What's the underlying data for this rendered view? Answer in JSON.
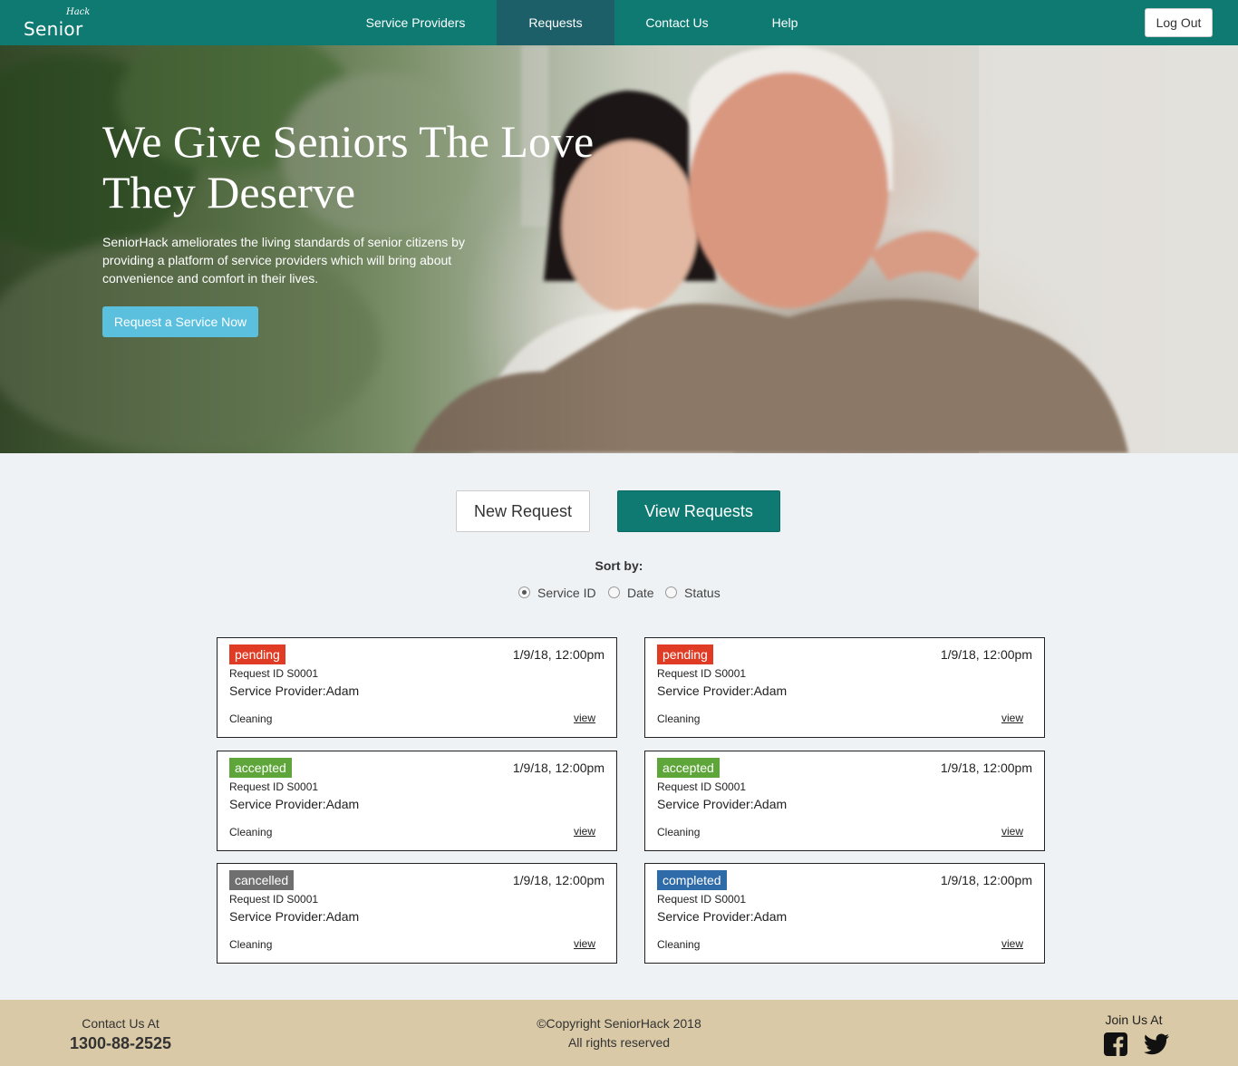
{
  "logo": {
    "hack": "Hack",
    "senior": "Senior"
  },
  "nav": {
    "items": [
      {
        "label": "Service Providers"
      },
      {
        "label": "Requests"
      },
      {
        "label": "Contact Us"
      },
      {
        "label": "Help"
      }
    ],
    "logout_label": "Log Out"
  },
  "hero": {
    "title": "We Give Seniors The Love They Deserve",
    "text": "SeniorHack ameliorates the living standards of senior citizens by providing a platform of service providers which will bring about convenience and comfort in their lives.",
    "cta_label": "Request a Service Now"
  },
  "actions": {
    "new_label": "New Request",
    "view_label": "View Requests"
  },
  "sort": {
    "label": "Sort by:",
    "options": [
      {
        "label": "Service ID"
      },
      {
        "label": "Date"
      },
      {
        "label": "Status"
      }
    ],
    "selected": "Service ID"
  },
  "cards": [
    {
      "status": "pending",
      "date": "1/9/18, 12:00pm",
      "request_id": "Request ID S0001",
      "provider": "Service Provider:Adam",
      "type": "Cleaning",
      "view": "view"
    },
    {
      "status": "pending",
      "date": "1/9/18, 12:00pm",
      "request_id": "Request ID S0001",
      "provider": "Service Provider:Adam",
      "type": "Cleaning",
      "view": "view"
    },
    {
      "status": "accepted",
      "date": "1/9/18, 12:00pm",
      "request_id": "Request ID S0001",
      "provider": "Service Provider:Adam",
      "type": "Cleaning",
      "view": "view"
    },
    {
      "status": "accepted",
      "date": "1/9/18, 12:00pm",
      "request_id": "Request ID S0001",
      "provider": "Service Provider:Adam",
      "type": "Cleaning",
      "view": "view"
    },
    {
      "status": "cancelled",
      "date": "1/9/18, 12:00pm",
      "request_id": "Request ID S0001",
      "provider": "Service Provider:Adam",
      "type": "Cleaning",
      "view": "view"
    },
    {
      "status": "completed",
      "date": "1/9/18, 12:00pm",
      "request_id": "Request ID S0001",
      "provider": "Service Provider:Adam",
      "type": "Cleaning",
      "view": "view"
    }
  ],
  "footer": {
    "contact_label": "Contact Us At",
    "phone": "1300-88-2525",
    "copyright": "©Copyright SeniorHack 2018",
    "rights": "All rights reserved",
    "join_label": "Join Us At",
    "social": [
      "facebook-icon",
      "twitter-icon"
    ]
  },
  "colors": {
    "primary": "#0e7a72",
    "nav_active": "#1d5f68",
    "cta": "#5bc0de",
    "footer": "#d9c9a6",
    "pending": "#e03b24",
    "accepted": "#5ea63a",
    "cancelled": "#6f6f6f",
    "completed": "#2f6ba8"
  }
}
